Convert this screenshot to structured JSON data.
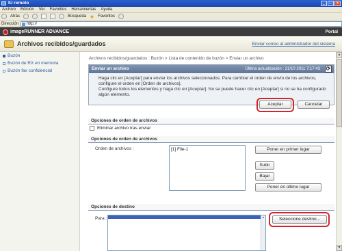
{
  "window": {
    "title": "IU remoto",
    "controls": [
      "_",
      "□",
      "×"
    ]
  },
  "menu": [
    "Archivo",
    "Edición",
    "Ver",
    "Favoritos",
    "Herramientas",
    "Ayuda"
  ],
  "toolbar": {
    "back": "Atrás",
    "search": "Búsqueda",
    "favorites": "Favoritos"
  },
  "address": {
    "label": "Dirección",
    "value": "http://"
  },
  "app": {
    "brand": "imageRUNNER ADVANCE",
    "portal": "Portal"
  },
  "page": {
    "title": "Archivos recibidos/guardados",
    "admin_link": "Enviar correo al administrador del sistema"
  },
  "sidebar": {
    "items": [
      {
        "label": "Buzón"
      },
      {
        "label": "Buzón de RX en memoria"
      },
      {
        "label": "Buzón fax confidencial"
      }
    ]
  },
  "breadcrumb": "Archivos recibidos/guardados : Buzón > Lista de contenido de buzón > Enviar un archivo",
  "send_panel": {
    "title": "Enviar un archivo",
    "last_update": "Última actualización : 21/10 2011 7:17:43",
    "instructions_1": "Haga clic en [Aceptar] para enviar los archivos seleccionados. Para cambiar el orden de envío de los archivos, configure el orden en [Orden de archivos].",
    "instructions_2": "Configure todos los elementos y haga clic en [Aceptar]. No se puede hacer clic en [Aceptar] si no se ha configurado algún elemento.",
    "accept": "Aceptar",
    "cancel": "Cancelar"
  },
  "file_order_options": {
    "section_title": "Opciones de orden de archivos",
    "delete_after_send": "Eliminar archivo tras enviar"
  },
  "file_order": {
    "section_title": "Opciones de orden de archivos",
    "label": "Orden de archivos :",
    "files": [
      "[1] File-1"
    ],
    "first_place": "Poner en primer lugar",
    "up": "Subir",
    "down": "Bajar",
    "last_place": "Poner en último lugar"
  },
  "destination": {
    "section_title": "Opciones de destino",
    "label": "Para :",
    "select_button": "Seleccione destino..."
  }
}
